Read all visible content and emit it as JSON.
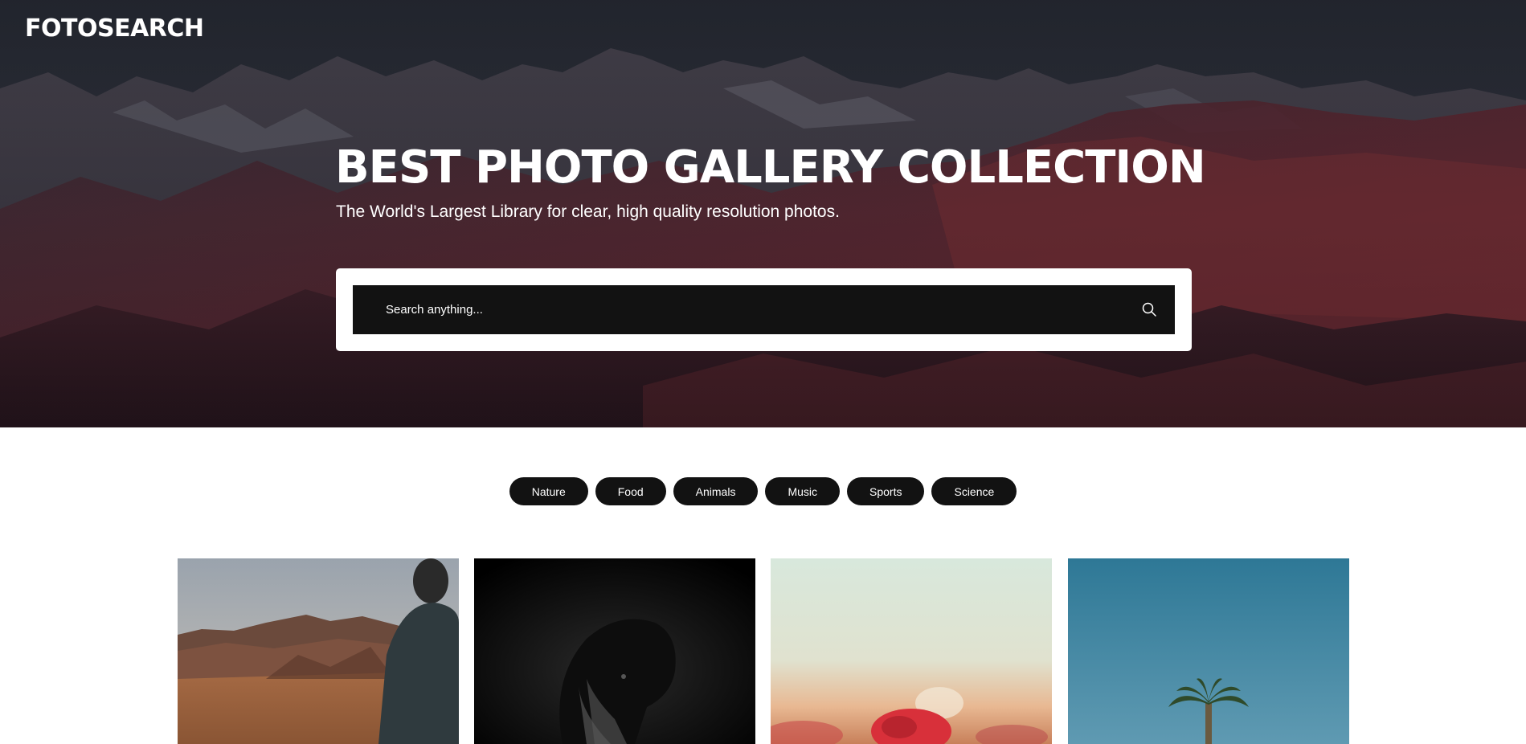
{
  "brand": {
    "logo_text": "FOTOSEARCH"
  },
  "hero": {
    "title": "BEST PHOTO GALLERY COLLECTION",
    "subtitle": "The World's Largest Library for clear, high quality resolution photos."
  },
  "search": {
    "placeholder": "Search anything...",
    "value": "",
    "icon": "search-icon"
  },
  "categories": [
    "Nature",
    "Food",
    "Animals",
    "Music",
    "Sports",
    "Science"
  ],
  "gallery": {
    "photos": [
      {
        "subject": "desert-canyon-man-photo"
      },
      {
        "subject": "black-swan-photo"
      },
      {
        "subject": "red-poppy-flower-photo"
      },
      {
        "subject": "palm-tree-sky-photo"
      }
    ]
  },
  "colors": {
    "dark_button": "#121212",
    "hero_accent": "#6e2a2e",
    "text_on_dark": "#ffffff"
  }
}
